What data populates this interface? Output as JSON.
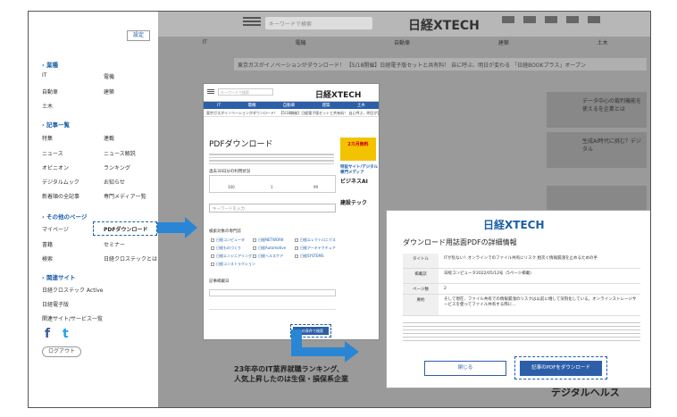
{
  "sidebar": {
    "settings_label": "設定",
    "sections": [
      {
        "title": "業種",
        "items": [
          "IT",
          "電機",
          "自動車",
          "建築",
          "土木"
        ]
      },
      {
        "title": "記事一覧",
        "items": [
          "特集",
          "連載",
          "ニュース",
          "ニュース解説",
          "オピニオン",
          "ランキング",
          "デジタルムック",
          "お知らせ",
          "新着順の全記事",
          "専門メディア一覧"
        ]
      },
      {
        "title": "その他のページ",
        "items": [
          "マイページ",
          "PDFダウンロード",
          "書籍",
          "セミナー",
          "検索",
          "日経クロステックとは"
        ]
      },
      {
        "title": "関連サイト",
        "items": [
          "日経クロステック Active",
          "日経電子版",
          "関連サイト/サービス一覧"
        ]
      }
    ],
    "social": {
      "facebook": "f",
      "twitter": "t"
    },
    "logout_label": "ログアウト"
  },
  "background_site": {
    "search_placeholder": "キーワードで検索",
    "logo": "日経XTECH",
    "nav": [
      "IT",
      "電機",
      "自動車",
      "建築",
      "土木"
    ],
    "ticker": "東京ガスがイノベーションがダウンロード！ 【5/18開催】日経電子版セットと共有料！ 自に呼ぶ、明日が変わる 「日経BOOKプラス」オープン",
    "side_texts": [
      "データ中心の裁判機能を使えるを企業とは",
      "生成AI時代に挑む？デジタル",
      "23年卒のIT業界就職ランキング、人気上昇したのは生保・損保系企業",
      "デジタルヘルス"
    ]
  },
  "screen1": {
    "logo": "日経XTECH",
    "title": "PDFダウンロード",
    "nav": [
      "IT",
      "電機",
      "自動車",
      "建築",
      "土木"
    ],
    "ticker": "東京ガスがイノベーションがダウンロード！ 【5/18開催】日経電子版セットと共有料！ 自に呼ぶ、明日が変わる",
    "usage_label": "過去30日分の利用状況",
    "usage_values": [
      "100",
      "1",
      "99"
    ],
    "keyword_placeholder": "キーワードを入力",
    "target_label": "検索対象の専門誌",
    "checkboxes": [
      "日経コンピュータ",
      "日経NETWORK",
      "日経エレクトロニクス",
      "日経ものづくり",
      "日経Automotive",
      "日経アーキテクチュア",
      "日経エンジニアリング",
      "日経ヘルスケア",
      "日経SYSTEMS",
      "日経コンストラクション"
    ],
    "date_label": "記事掲載日",
    "search_button": "この条件で検索",
    "ad_text": "2カ月無料",
    "side_links": [
      "特設サイト/デジタル専門メディア",
      "ビジネスAI",
      "建設テック"
    ]
  },
  "screen2": {
    "logo_prefix": "日経",
    "logo_main": "XTECH",
    "title": "ダウンロード用誌面PDFの詳細情報",
    "rows": [
      {
        "key": "タイトル",
        "value": "ITが危ない！オンラインでのファイル共有にリスク 相次ぐ情報漏洩を止めるための手"
      },
      {
        "key": "掲載誌",
        "value": "日経コンピュータ2022/05/12号（5ページ掲載）"
      },
      {
        "key": "ページ数",
        "value": "2"
      },
      {
        "key": "要約",
        "value": "そして現在、ファイル共有での情報漏洩のリスクは以前に増して深刻化している。オンラインストレージサービスを使ってファイル共有する際に…"
      }
    ],
    "close_button": "閉じる",
    "download_button": "記事のPDFをダウンロード"
  }
}
